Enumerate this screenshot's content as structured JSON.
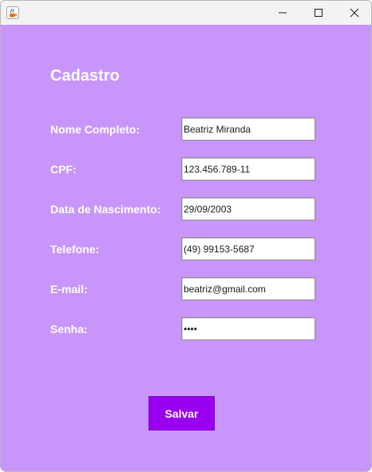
{
  "window": {
    "app_icon": "java-coffee-cup-icon",
    "controls": [
      "minimize-icon",
      "maximize-icon",
      "close-icon"
    ]
  },
  "form": {
    "title": "Cadastro",
    "fields": [
      {
        "label": "Nome Completo:",
        "value": "Beatriz Miranda"
      },
      {
        "label": "CPF:",
        "value": "123.456.789-11"
      },
      {
        "label": "Data de Nascimento:",
        "value": "29/09/2003"
      },
      {
        "label": "Telefone:",
        "value": "(49) 99153-5687"
      },
      {
        "label": "E-mail:",
        "value": "beatriz@gmail.com"
      },
      {
        "label": "Senha:",
        "value": "••••"
      }
    ],
    "save_label": "Salvar"
  },
  "colors": {
    "background": "#c896fa",
    "button": "#9a00f0",
    "label_text": "#ffffff"
  }
}
